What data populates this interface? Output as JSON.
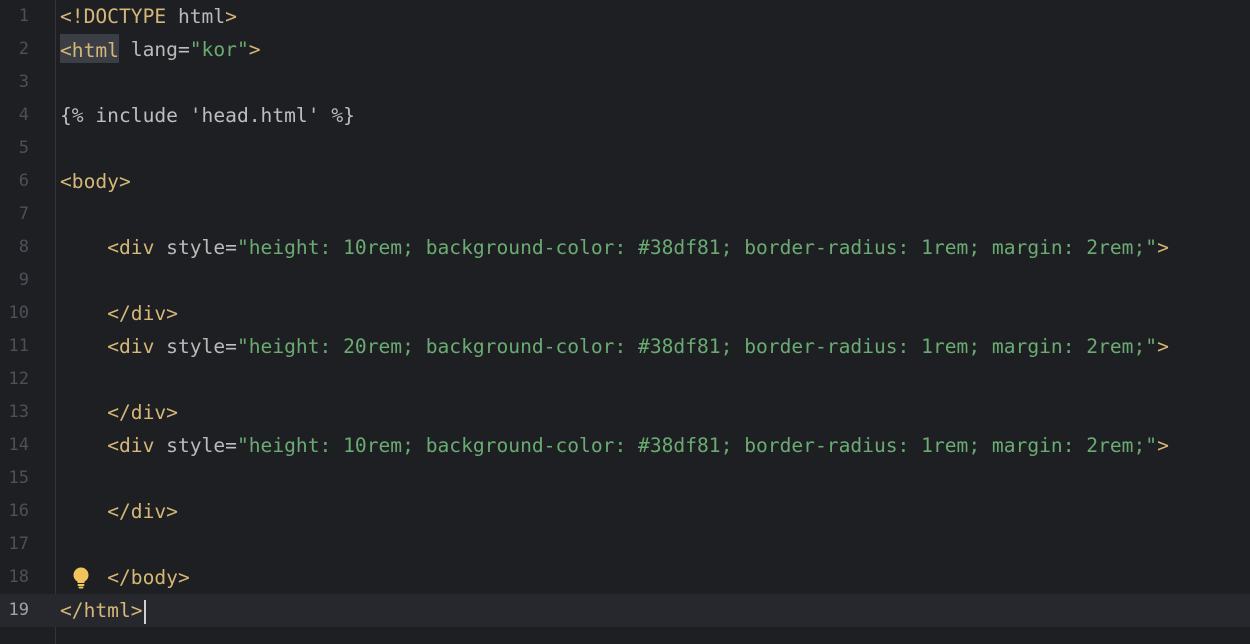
{
  "editor": {
    "current_line": "19",
    "lines": [
      {
        "n": "1",
        "t": [
          {
            "c": "tag",
            "v": "<!DOCTYPE "
          },
          {
            "c": "attr",
            "v": "html"
          },
          {
            "c": "tag",
            "v": ">"
          }
        ]
      },
      {
        "n": "2",
        "t": [
          {
            "c": "tag-hl",
            "v": "<html"
          },
          {
            "c": "txt",
            "v": " "
          },
          {
            "c": "attr",
            "v": "lang"
          },
          {
            "c": "txt",
            "v": "="
          },
          {
            "c": "str",
            "v": "\"kor\""
          },
          {
            "c": "tag",
            "v": ">"
          }
        ]
      },
      {
        "n": "3",
        "t": []
      },
      {
        "n": "4",
        "t": [
          {
            "c": "txt",
            "v": "{% include 'head.html' %}"
          }
        ]
      },
      {
        "n": "5",
        "t": []
      },
      {
        "n": "6",
        "t": [
          {
            "c": "tag",
            "v": "<body>"
          }
        ]
      },
      {
        "n": "7",
        "t": []
      },
      {
        "n": "8",
        "t": [
          {
            "c": "txt",
            "v": "    "
          },
          {
            "c": "tag",
            "v": "<div"
          },
          {
            "c": "txt",
            "v": " "
          },
          {
            "c": "attr",
            "v": "style"
          },
          {
            "c": "txt",
            "v": "="
          },
          {
            "c": "str",
            "v": "\"height: 10rem; background-color: #38df81; border-radius: 1rem; margin: 2rem;\""
          },
          {
            "c": "tag",
            "v": ">"
          }
        ]
      },
      {
        "n": "9",
        "t": []
      },
      {
        "n": "10",
        "t": [
          {
            "c": "txt",
            "v": "    "
          },
          {
            "c": "tag",
            "v": "</div>"
          }
        ]
      },
      {
        "n": "11",
        "t": [
          {
            "c": "txt",
            "v": "    "
          },
          {
            "c": "tag",
            "v": "<div"
          },
          {
            "c": "txt",
            "v": " "
          },
          {
            "c": "attr",
            "v": "style"
          },
          {
            "c": "txt",
            "v": "="
          },
          {
            "c": "str",
            "v": "\"height: 20rem; background-color: #38df81; border-radius: 1rem; margin: 2rem;\""
          },
          {
            "c": "tag",
            "v": ">"
          }
        ]
      },
      {
        "n": "12",
        "t": []
      },
      {
        "n": "13",
        "t": [
          {
            "c": "txt",
            "v": "    "
          },
          {
            "c": "tag",
            "v": "</div>"
          }
        ]
      },
      {
        "n": "14",
        "t": [
          {
            "c": "txt",
            "v": "    "
          },
          {
            "c": "tag",
            "v": "<div"
          },
          {
            "c": "txt",
            "v": " "
          },
          {
            "c": "attr",
            "v": "style"
          },
          {
            "c": "txt",
            "v": "="
          },
          {
            "c": "str",
            "v": "\"height: 10rem; background-color: #38df81; border-radius: 1rem; margin: 2rem;\""
          },
          {
            "c": "tag",
            "v": ">"
          }
        ]
      },
      {
        "n": "15",
        "t": []
      },
      {
        "n": "16",
        "t": [
          {
            "c": "txt",
            "v": "    "
          },
          {
            "c": "tag",
            "v": "</div>"
          }
        ]
      },
      {
        "n": "17",
        "t": []
      },
      {
        "n": "18",
        "t": [
          {
            "c": "txt",
            "v": "    "
          },
          {
            "c": "tag",
            "v": "</body>"
          }
        ]
      },
      {
        "n": "19",
        "t": [
          {
            "c": "tag",
            "v": "</html>"
          }
        ]
      }
    ],
    "intention_icon": "lightbulb-icon",
    "colors": {
      "background": "#1e1f22",
      "tag": "#d5b778",
      "string": "#6aab73",
      "attribute": "#bababa",
      "text": "#bcbec4",
      "line_number": "#4b5059"
    }
  }
}
